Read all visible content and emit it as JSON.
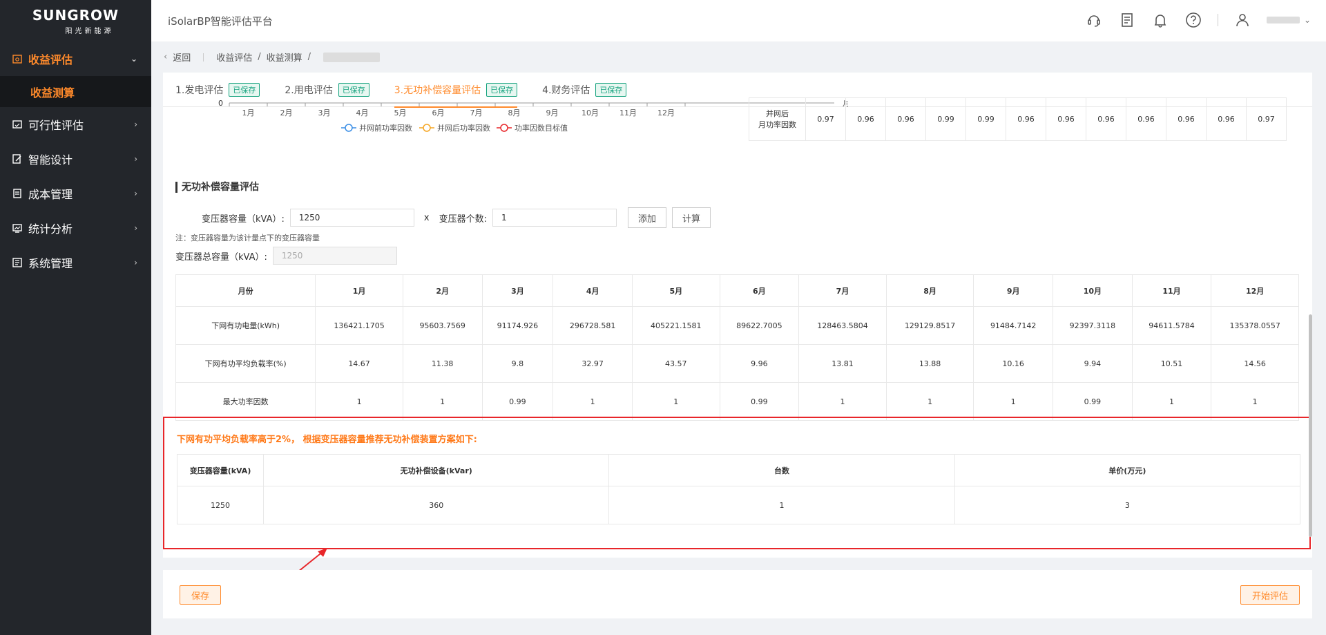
{
  "app": {
    "brand": "SUNGROW",
    "brand_sub": "阳光新能源",
    "title": "iSolarBP智能评估平台"
  },
  "sidebar": {
    "items": [
      {
        "label": "收益评估",
        "icon": "revenue-icon",
        "active": true,
        "expanded": true
      },
      {
        "label": "可行性评估",
        "icon": "feasibility-icon"
      },
      {
        "label": "智能设计",
        "icon": "design-icon"
      },
      {
        "label": "成本管理",
        "icon": "cost-icon"
      },
      {
        "label": "统计分析",
        "icon": "stats-icon"
      },
      {
        "label": "系统管理",
        "icon": "system-icon"
      }
    ],
    "sub_item": "收益测算"
  },
  "breadcrumb": {
    "back": "返回",
    "level1": "收益评估",
    "level2": "收益测算"
  },
  "tabs": [
    {
      "label": "1.发电评估",
      "badge": "已保存"
    },
    {
      "label": "2.用电评估",
      "badge": "已保存"
    },
    {
      "label": "3.无功补偿容量评估",
      "badge": "已保存",
      "active": true
    },
    {
      "label": "4.财务评估",
      "badge": "已保存"
    }
  ],
  "chart_partial": {
    "y_zero": "0",
    "months": [
      "1月",
      "2月",
      "3月",
      "4月",
      "5月",
      "6月",
      "7月",
      "8月",
      "9月",
      "10月",
      "11月",
      "12月"
    ],
    "x_unit": "月份",
    "legend": [
      "并网前功率因数",
      "并网后功率因数",
      "功率因数目标值"
    ],
    "legend_colors": [
      "#3a8ee6",
      "#f5a623",
      "#e8262a"
    ]
  },
  "pf_table": {
    "label_line1": "并网后",
    "label_line2": "月功率因数",
    "values": [
      "0.97",
      "0.96",
      "0.96",
      "0.99",
      "0.99",
      "0.96",
      "0.96",
      "0.96",
      "0.96",
      "0.96",
      "0.96",
      "0.97"
    ]
  },
  "section": {
    "title": "无功补偿容量评估"
  },
  "form": {
    "capacity_label": "变压器容量（kVA）:",
    "capacity_value": "1250",
    "times": "x",
    "count_label": "变压器个数:",
    "count_value": "1",
    "add": "添加",
    "calc": "计算",
    "note": "注：变压器容量为该计量点下的变压器容量",
    "total_label": "变压器总容量（kVA）:",
    "total_value": "1250"
  },
  "monthly_table": {
    "headers": [
      "月份",
      "1月",
      "2月",
      "3月",
      "4月",
      "5月",
      "6月",
      "7月",
      "8月",
      "9月",
      "10月",
      "11月",
      "12月"
    ],
    "rows": [
      [
        "下网有功电量(kWh)",
        "136421.1705",
        "95603.7569",
        "91174.926",
        "296728.581",
        "405221.1581",
        "89622.7005",
        "128463.5804",
        "129129.8517",
        "91484.7142",
        "92397.3118",
        "94611.5784",
        "135378.0557"
      ],
      [
        "下网有功平均负载率(%)",
        "14.67",
        "11.38",
        "9.8",
        "32.97",
        "43.57",
        "9.96",
        "13.81",
        "13.88",
        "10.16",
        "9.94",
        "10.51",
        "14.56"
      ],
      [
        "最大功率因数",
        "1",
        "1",
        "0.99",
        "1",
        "1",
        "0.99",
        "1",
        "1",
        "1",
        "0.99",
        "1",
        "1"
      ]
    ]
  },
  "recommendation": {
    "message": "下网有功平均负载率高于2%， 根据变压器容量推荐无功补偿装置方案如下:",
    "headers": [
      "变压器容量(kVA)",
      "无功补偿设备(kVar)",
      "台数",
      "单价(万元)"
    ],
    "row": [
      "1250",
      "360",
      "1",
      "3"
    ]
  },
  "footer": {
    "save": "保存",
    "start": "开始评估"
  }
}
